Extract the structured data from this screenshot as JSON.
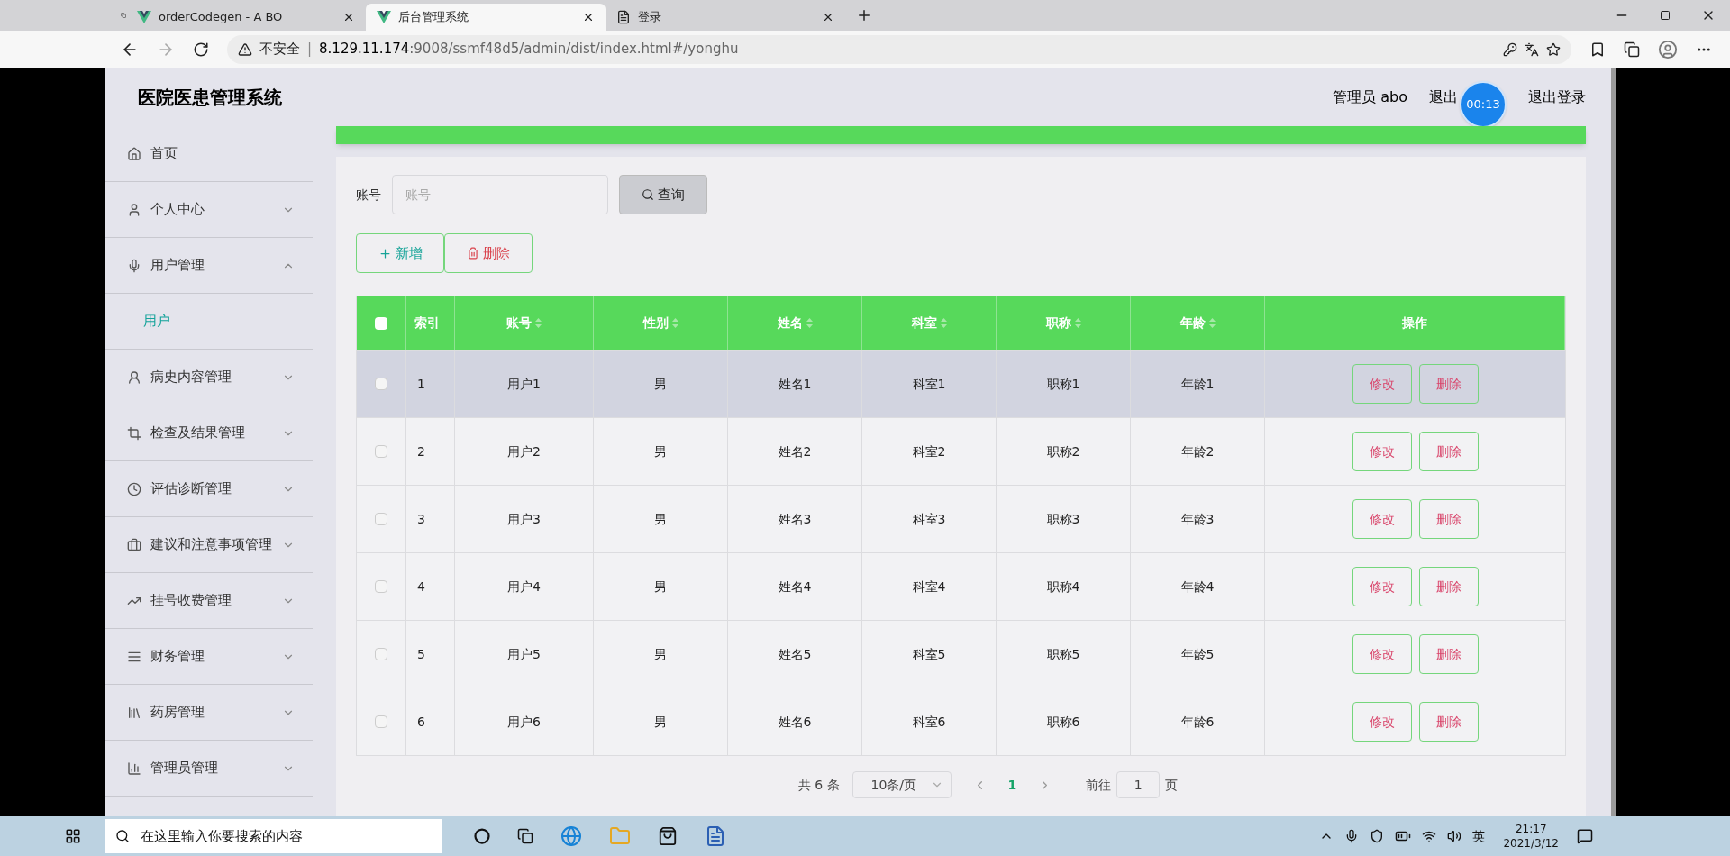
{
  "browser": {
    "tabs": [
      {
        "title": "orderCodegen - A BO",
        "selected": false
      },
      {
        "title": "后台管理系统",
        "selected": true
      },
      {
        "title": "登录",
        "selected": false
      }
    ],
    "security": "不安全",
    "separator": "|",
    "host": "8.129.11.174",
    "path": ":9008/ssmf48d5/admin/dist/index.html#/yonghu"
  },
  "app": {
    "title": "医院医患管理系统",
    "header_links": [
      {
        "label": "管理员 abo"
      },
      {
        "label": "退出"
      },
      {
        "label": "退出登录"
      }
    ],
    "timer": "00:13"
  },
  "sidebar": {
    "items": [
      {
        "label": "首页"
      },
      {
        "label": "个人中心",
        "expanded": false
      },
      {
        "label": "用户管理",
        "expanded": true,
        "children": [
          {
            "label": "用户",
            "selected": true
          }
        ]
      },
      {
        "label": "病史内容管理",
        "expanded": false
      },
      {
        "label": "检查及结果管理",
        "expanded": false
      },
      {
        "label": "评估诊断管理",
        "expanded": false
      },
      {
        "label": "建议和注意事项管理",
        "expanded": false
      },
      {
        "label": "挂号收费管理",
        "expanded": false
      },
      {
        "label": "财务管理",
        "expanded": false
      },
      {
        "label": "药房管理",
        "expanded": false
      },
      {
        "label": "管理员管理",
        "expanded": false
      }
    ]
  },
  "search": {
    "label": "账号",
    "placeholder": "账号",
    "button": "查询"
  },
  "actions": [
    {
      "label": "新增",
      "kind": "add"
    },
    {
      "label": "删除",
      "kind": "delete"
    }
  ],
  "table": {
    "select_all_checked": false,
    "columns": [
      {
        "label": "索引",
        "sortable": false
      },
      {
        "label": "账号",
        "sortable": true
      },
      {
        "label": "性别",
        "sortable": true
      },
      {
        "label": "姓名",
        "sortable": true
      },
      {
        "label": "科室",
        "sortable": true
      },
      {
        "label": "职称",
        "sortable": true
      },
      {
        "label": "年龄",
        "sortable": true
      },
      {
        "label": "操作",
        "sortable": false
      }
    ],
    "rows": [
      {
        "checked": false,
        "highlighted": true,
        "cells": [
          "1",
          "用户1",
          "男",
          "姓名1",
          "科室1",
          "职称1",
          "年龄1"
        ],
        "actions": [
          "修改",
          "删除"
        ]
      },
      {
        "checked": false,
        "highlighted": false,
        "cells": [
          "2",
          "用户2",
          "男",
          "姓名2",
          "科室2",
          "职称2",
          "年龄2"
        ],
        "actions": [
          "修改",
          "删除"
        ]
      },
      {
        "checked": false,
        "highlighted": false,
        "cells": [
          "3",
          "用户3",
          "男",
          "姓名3",
          "科室3",
          "职称3",
          "年龄3"
        ],
        "actions": [
          "修改",
          "删除"
        ]
      },
      {
        "checked": false,
        "highlighted": false,
        "cells": [
          "4",
          "用户4",
          "男",
          "姓名4",
          "科室4",
          "职称4",
          "年龄4"
        ],
        "actions": [
          "修改",
          "删除"
        ]
      },
      {
        "checked": false,
        "highlighted": false,
        "cells": [
          "5",
          "用户5",
          "男",
          "姓名5",
          "科室5",
          "职称5",
          "年龄5"
        ],
        "actions": [
          "修改",
          "删除"
        ]
      },
      {
        "checked": false,
        "highlighted": false,
        "cells": [
          "6",
          "用户6",
          "男",
          "姓名6",
          "科室6",
          "职称6",
          "年龄6"
        ],
        "actions": [
          "修改",
          "删除"
        ]
      }
    ]
  },
  "pagination": {
    "total": "共 6 条",
    "page_size": "10条/页",
    "pages": [
      {
        "label": "1",
        "selected": true
      }
    ],
    "goto_label": "前往",
    "goto_value": "1",
    "goto_suffix": "页"
  },
  "taskbar": {
    "search_placeholder": "在这里输入你要搜索的内容",
    "ime": "英",
    "time": "21:17",
    "date": "2021/3/12"
  }
}
